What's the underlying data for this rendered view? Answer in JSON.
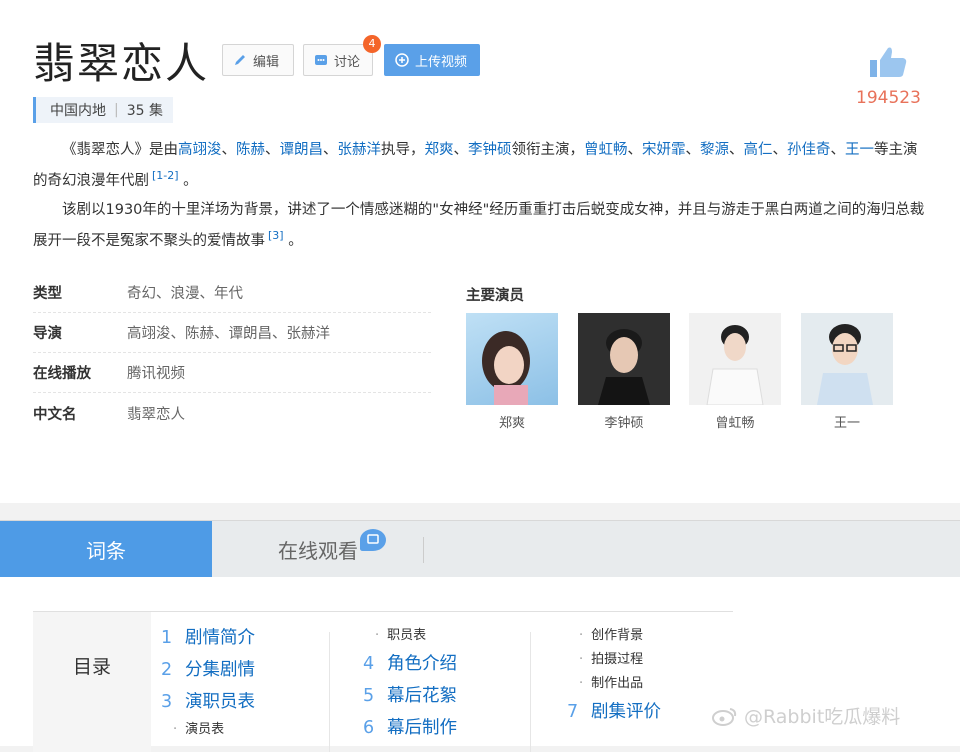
{
  "header": {
    "title": "翡翠恋人",
    "edit_label": "编辑",
    "discuss_label": "讨论",
    "discuss_badge": "4",
    "upload_label": "上传视频",
    "like_count": "194523"
  },
  "tags": {
    "region": "中国内地",
    "episodes": "35 集"
  },
  "summary": {
    "p1_prefix": "《翡翠恋人》是由",
    "directors": [
      "高翊浚",
      "陈赫",
      "谭朗昌",
      "张赫洋"
    ],
    "p1_direct": "执导，",
    "leads": [
      "郑爽",
      "李钟硕"
    ],
    "p1_lead": "领衔主演，",
    "costars": [
      "曾虹畅",
      "宋妍霏",
      "黎源",
      "高仁",
      "孙佳奇",
      "王一"
    ],
    "p1_suffix": "等主演的奇幻浪漫年代剧",
    "p1_ref": "[1-2]",
    "p1_end": "。",
    "p2_text": "该剧以1930年的十里洋场为背景，讲述了一个情感迷糊的\"女神经\"经历重重打击后蜕变成女神，并且与游走于黑白两道之间的海归总裁展开一段不是冤家不聚头的爱情故事",
    "p2_ref": "[3]",
    "p2_end": "。"
  },
  "info": {
    "genre_label": "类型",
    "genre_value": "奇幻、浪漫、年代",
    "director_label": "导演",
    "director_value": "高翊浚、陈赫、谭朗昌、张赫洋",
    "online_label": "在线播放",
    "online_value": "腾讯视频",
    "cn_name_label": "中文名",
    "cn_name_value": "翡翠恋人"
  },
  "cast": {
    "title": "主要演员",
    "actors": [
      {
        "name": "郑爽",
        "bg": "#9ec7e8"
      },
      {
        "name": "李钟硕",
        "bg": "#3a3a3a"
      },
      {
        "name": "曾虹畅",
        "bg": "#e8e8e8"
      },
      {
        "name": "王一",
        "bg": "#dfe6ea"
      }
    ]
  },
  "tabs": {
    "entry": "词条",
    "watch_online": "在线观看"
  },
  "toc": {
    "heading": "目录",
    "col1": [
      {
        "num": "1",
        "label": "剧情简介"
      },
      {
        "num": "2",
        "label": "分集剧情"
      },
      {
        "num": "3",
        "label": "演职员表"
      }
    ],
    "col1_sub": "演员表",
    "col2_sub_top": "职员表",
    "col2": [
      {
        "num": "4",
        "label": "角色介绍"
      },
      {
        "num": "5",
        "label": "幕后花絮"
      },
      {
        "num": "6",
        "label": "幕后制作"
      }
    ],
    "col3_subs": [
      "创作背景",
      "拍摄过程",
      "制作出品"
    ],
    "col3_main": {
      "num": "7",
      "label": "剧集评价"
    }
  },
  "watermark": "@Rabbit吃瓜爆料",
  "colors": {
    "accent": "#5aa0e8",
    "link": "#136ec2",
    "like": "#e8725a",
    "badge": "#f4652a"
  }
}
